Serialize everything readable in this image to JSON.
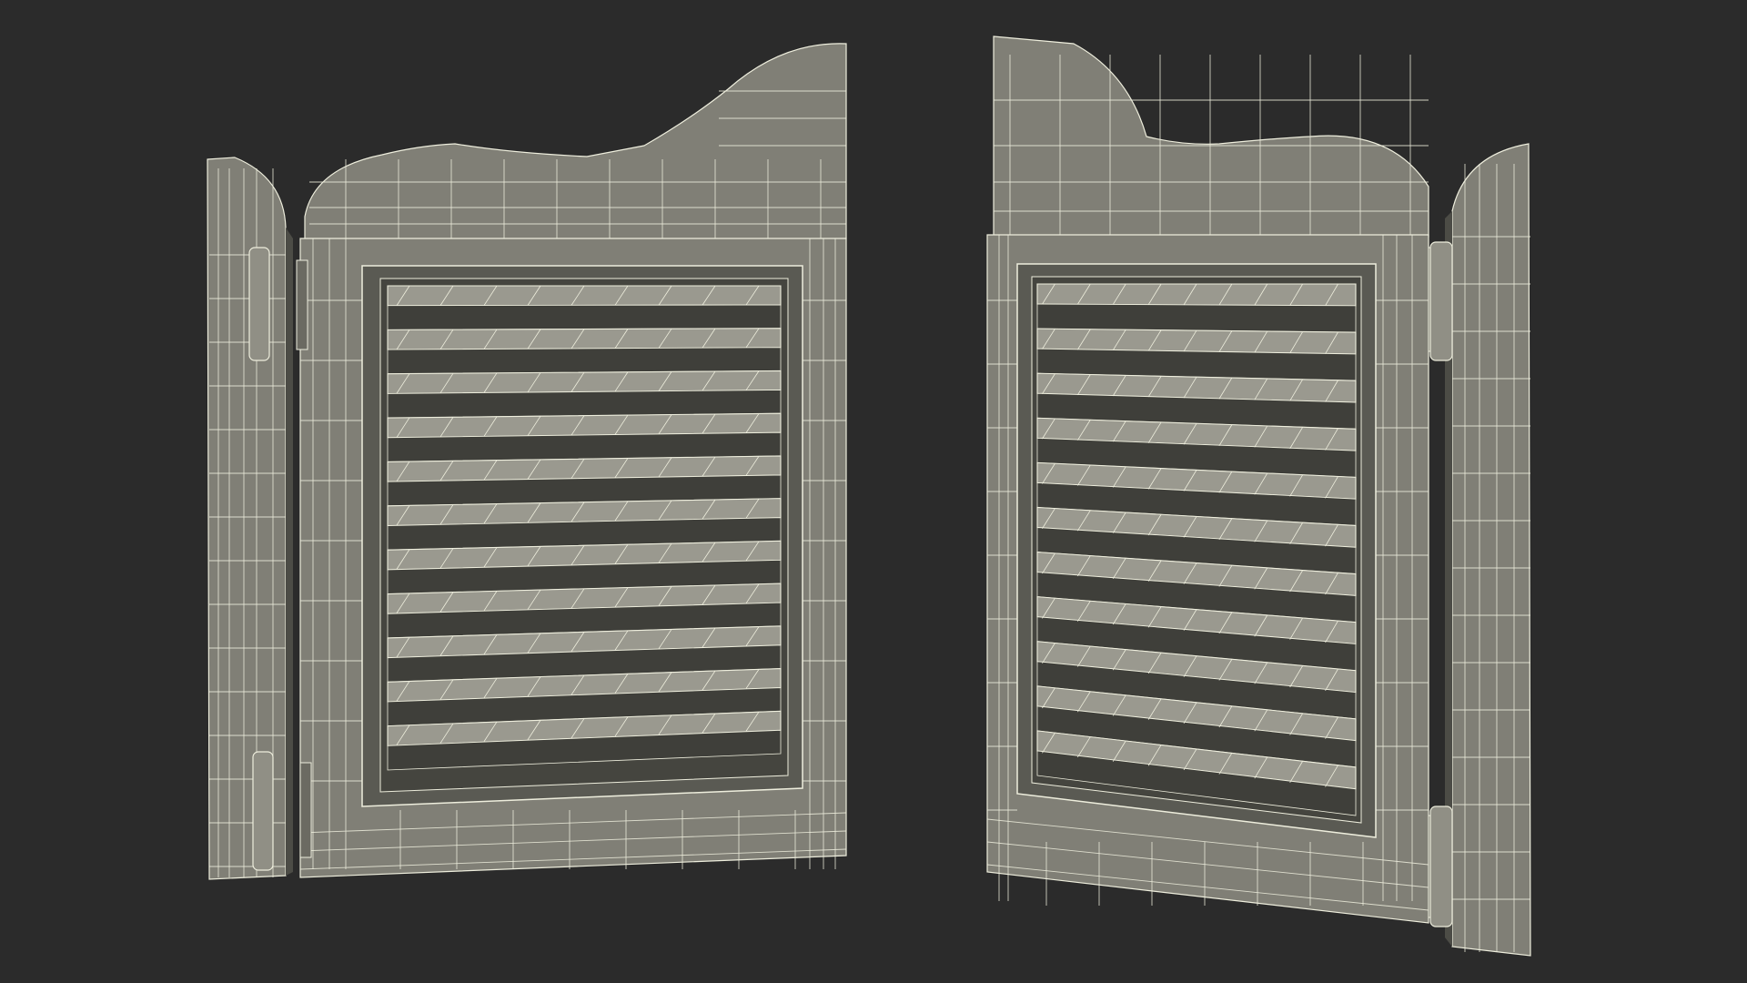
{
  "scene": {
    "background_color": "#2b2b2b",
    "surface_color": "#807f76",
    "surface_shadow": "#5c5b54",
    "surface_dark": "#45453f",
    "wire_color": "#eeeedd",
    "slat_light": "#9a998f",
    "slat_dark": "#3f3f3a",
    "objects": [
      {
        "name": "left-saloon-door",
        "louver_slats": 11,
        "hinges": 2
      },
      {
        "name": "right-saloon-door",
        "louver_slats": 11,
        "hinges": 2
      }
    ]
  }
}
